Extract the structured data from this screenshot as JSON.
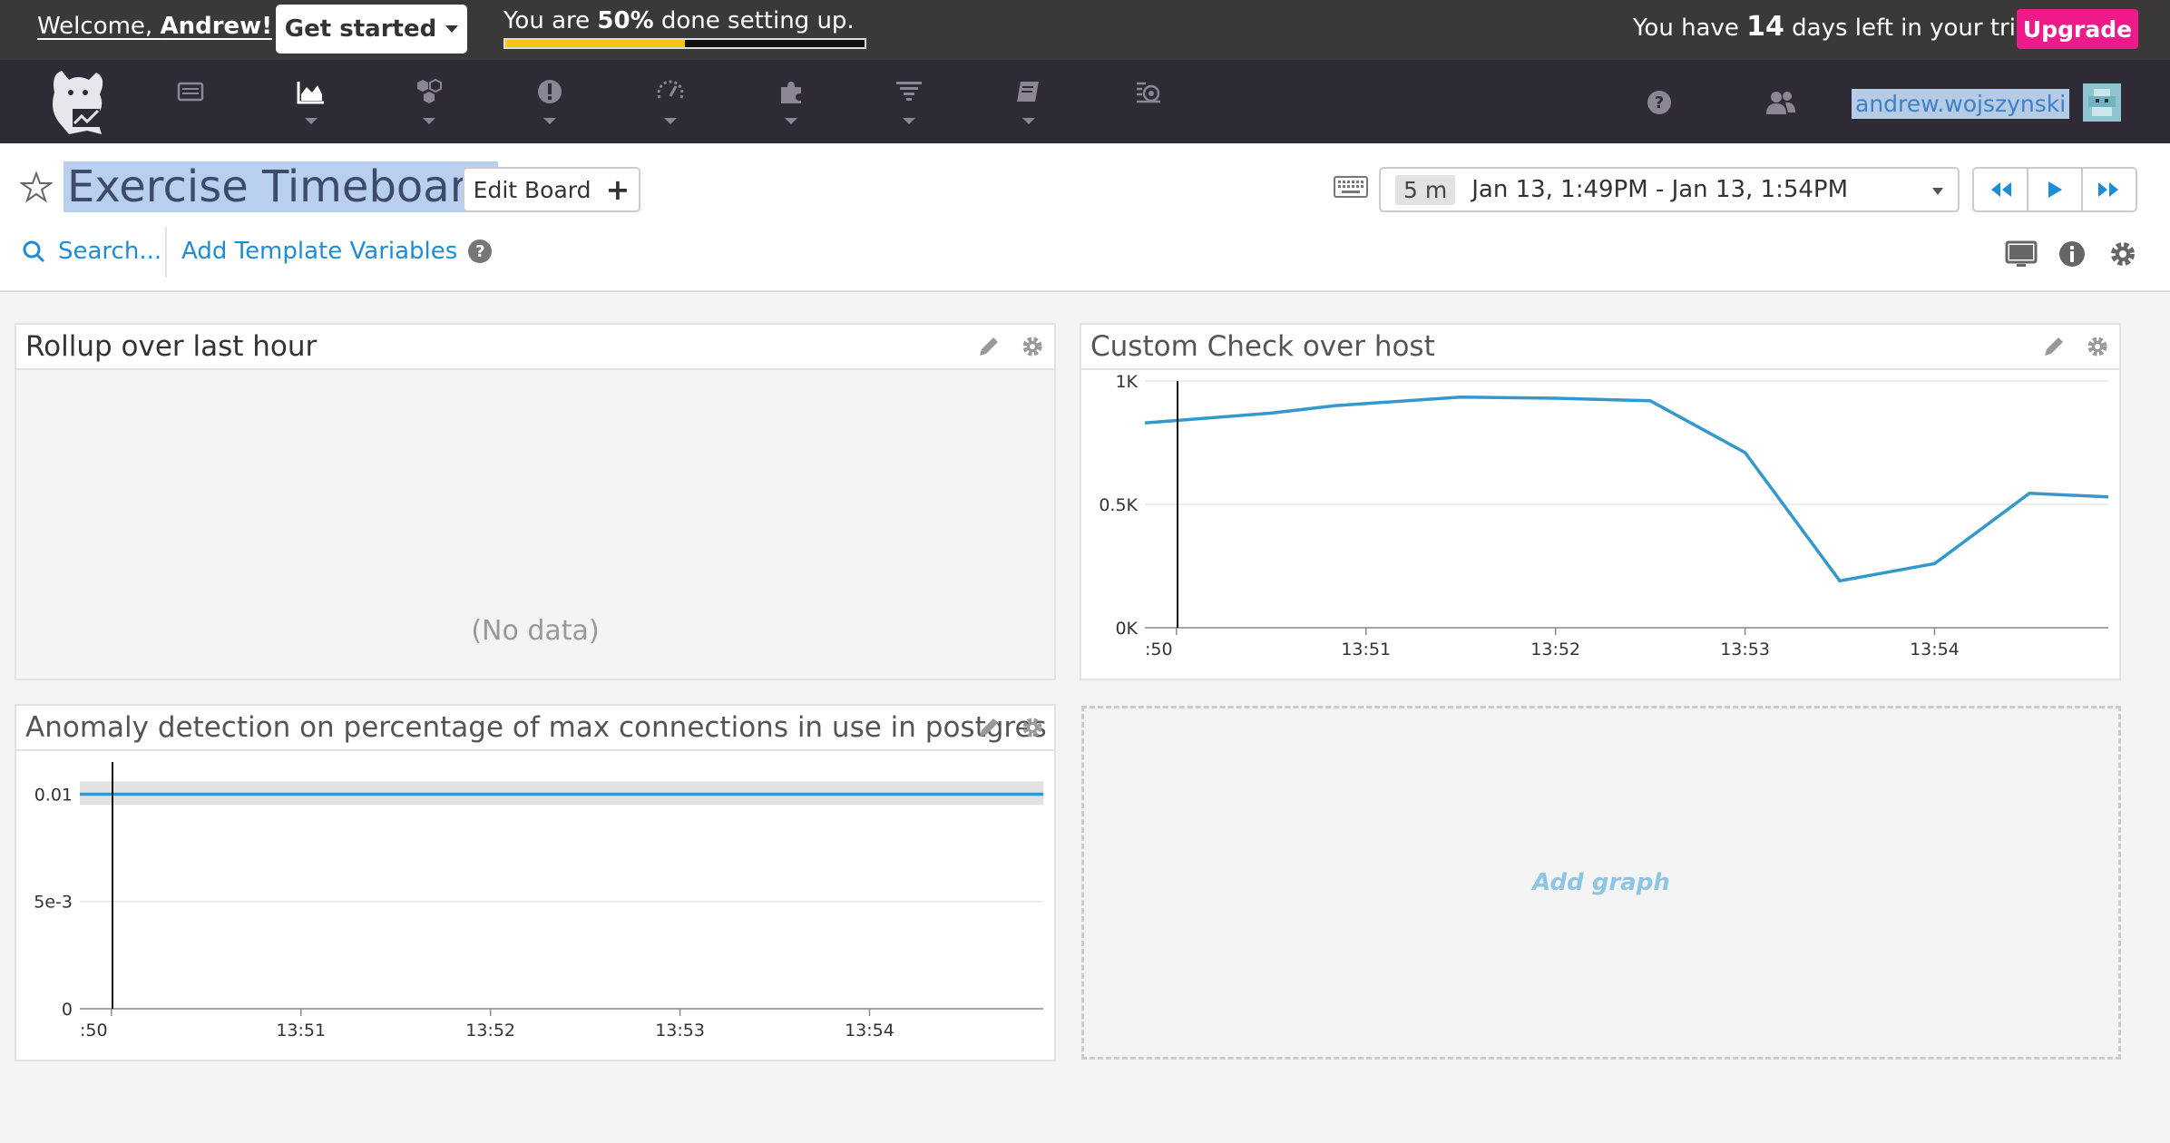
{
  "topbar": {
    "welcome_prefix": "Welcome, ",
    "welcome_name": "Andrew!",
    "get_started": "Get started",
    "progress_prefix": "You are ",
    "progress_percent_text": "50%",
    "progress_suffix": " done setting up.",
    "progress_value": 0.5,
    "trial_prefix": "You have ",
    "trial_days": "14",
    "trial_suffix": " days left in your trial.",
    "upgrade": "Upgrade",
    "colors": {
      "bar": "#3a3838",
      "progress": "#f5c518",
      "upgrade": "#ee1a8a"
    }
  },
  "navbar": {
    "items": [
      {
        "icon": "list-icon"
      },
      {
        "icon": "area-chart-icon",
        "active": true
      },
      {
        "icon": "infrastructure-icon"
      },
      {
        "icon": "alert-icon"
      },
      {
        "icon": "gauge-icon"
      },
      {
        "icon": "puzzle-icon"
      },
      {
        "icon": "filter-icon"
      },
      {
        "icon": "notebook-icon"
      },
      {
        "icon": "apm-icon"
      }
    ],
    "username": "andrew.wojszynski"
  },
  "header": {
    "title": "Exercise Timeboard",
    "edit_board": "Edit Board",
    "timeframe_badge": "5 m",
    "timeframe_text": "Jan 13, 1:49PM - Jan 13, 1:54PM",
    "search": "Search...",
    "template_vars": "Add Template Variables"
  },
  "widgets": {
    "rollup": {
      "title": "Rollup over last hour",
      "empty_text": "(No data)"
    },
    "custom_check": {
      "title": "Custom Check over host"
    },
    "anomaly": {
      "title": "Anomaly detection on percentage of max connections in use in postgres"
    },
    "add_graph": "Add graph"
  },
  "chart_data": [
    {
      "type": "line",
      "title": "Custom Check over host",
      "x": [
        "13:49:50",
        "13:50:30",
        "13:50:50",
        "13:51:30",
        "13:52:00",
        "13:52:30",
        "13:53:00",
        "13:53:30",
        "13:54:00",
        "13:54:30",
        "13:54:55"
      ],
      "series": [
        {
          "values": [
            830,
            870,
            900,
            935,
            930,
            920,
            710,
            190,
            260,
            545,
            530
          ]
        }
      ],
      "x_ticks": [
        ":50",
        "13:51",
        "13:52",
        "13:53",
        "13:54"
      ],
      "y_ticks": [
        "0K",
        "0.5K",
        "1K"
      ],
      "ylim": [
        0,
        1000
      ],
      "grid": true,
      "color": "#3498cc"
    },
    {
      "type": "line",
      "title": "Anomaly detection on percentage of max connections in use in postgres",
      "x": [
        "13:49:50",
        "13:54:55"
      ],
      "series": [
        {
          "values": [
            0.01,
            0.01
          ]
        }
      ],
      "band": [
        0.0095,
        0.0106
      ],
      "x_ticks": [
        ":50",
        "13:51",
        "13:52",
        "13:53",
        "13:54"
      ],
      "y_ticks": [
        "0",
        "5e-3",
        "0.01"
      ],
      "ylim": [
        0,
        0.0115
      ],
      "grid": true,
      "color": "#3498cc"
    }
  ]
}
